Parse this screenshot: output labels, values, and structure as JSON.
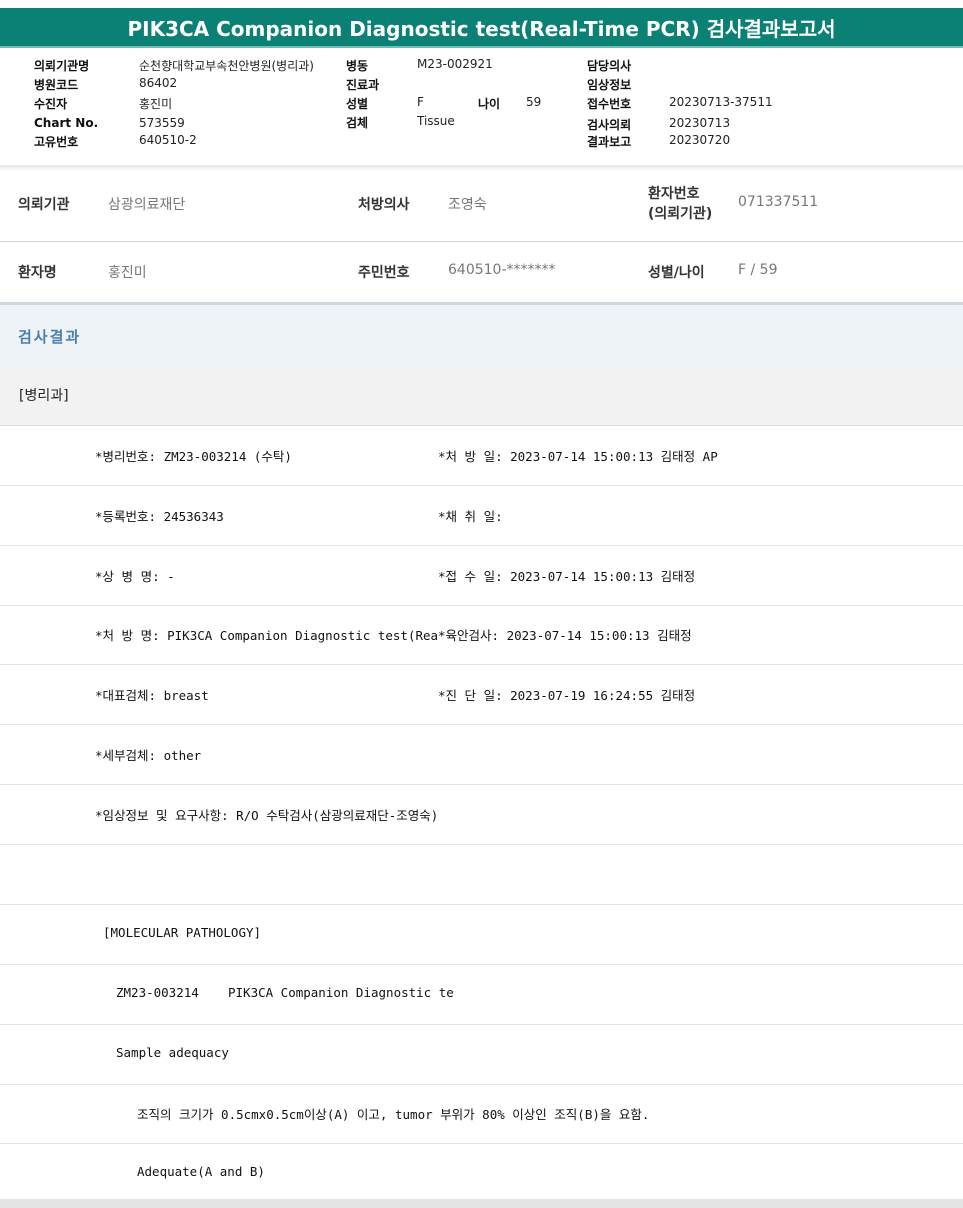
{
  "report_title": "PIK3CA Companion Diagnostic test(Real-Time PCR) 검사결과보고서",
  "header_info": {
    "col1": [
      {
        "label": "의뢰기관명",
        "value": "순천향대학교부속천안병원(병리과)"
      },
      {
        "label": "병원코드",
        "value": "86402"
      },
      {
        "label": "수진자",
        "value": "홍진미"
      },
      {
        "label": "Chart No.",
        "value": "573559"
      },
      {
        "label": "고유번호",
        "value": "640510-2"
      }
    ],
    "col2": [
      {
        "label": "병동",
        "value": "M23-002921"
      },
      {
        "label": "진료과",
        "value": ""
      },
      {
        "label": "성별",
        "value": "F"
      },
      {
        "label": "검체",
        "value": "Tissue"
      }
    ],
    "age": {
      "label": "나이",
      "value": "59"
    },
    "col3": [
      {
        "label": "담당의사",
        "value": ""
      },
      {
        "label": "임상정보",
        "value": ""
      },
      {
        "label": "접수번호",
        "value": "20230713-37511"
      },
      {
        "label": "검사의뢰",
        "value": "20230713"
      },
      {
        "label": "결과보고",
        "value": "20230720"
      }
    ]
  },
  "request_info": {
    "row1": [
      {
        "label": "의뢰기관",
        "value": "삼광의료재단"
      },
      {
        "label": "처방의사",
        "value": "조영숙"
      },
      {
        "label": "환자번호\n(의뢰기관)",
        "value": "071337511"
      }
    ],
    "row2": [
      {
        "label": "환자명",
        "value": "홍진미"
      },
      {
        "label": "주민번호",
        "value": "640510-*******"
      },
      {
        "label": "성별/나이",
        "value": "F / 59"
      }
    ]
  },
  "section_title": "검사결과",
  "department": "[병리과]",
  "result_rows": [
    {
      "left": "*병리번호: ZM23-003214 (수탁)",
      "right": "*처 방 일: 2023-07-14 15:00:13  김태정 AP"
    },
    {
      "left": "*등록번호: 24536343",
      "right": "*채 취 일:"
    },
    {
      "left": "*상 병 명: -",
      "right": "*접 수 일: 2023-07-14 15:00:13  김태정"
    },
    {
      "left": "*처 방 명: PIK3CA Companion Diagnostic test(Rea",
      "right": "*육안검사: 2023-07-14 15:00:13  김태정"
    },
    {
      "left": "*대표검체: breast",
      "right": "*진 단 일: 2023-07-19 16:24:55  김태정"
    },
    {
      "left": "*세부검체: other",
      "right": ""
    },
    {
      "left": "*임상정보 및 요구사항: R/O 수탁검사(삼광의료재단-조영숙)",
      "right": ""
    },
    {
      "left": "",
      "right": ""
    }
  ],
  "molecular": {
    "heading": "[MOLECULAR PATHOLOGY]",
    "case_id": "ZM23-003214",
    "test_name": "PIK3CA Companion Diagnostic te",
    "adequacy_label": "Sample adequacy",
    "criteria": "조직의 크기가 0.5cmx0.5cm이상(A) 이고, tumor 부위가 80% 이상인 조직(B)을 요함.",
    "result": "Adequate(A and B)"
  }
}
